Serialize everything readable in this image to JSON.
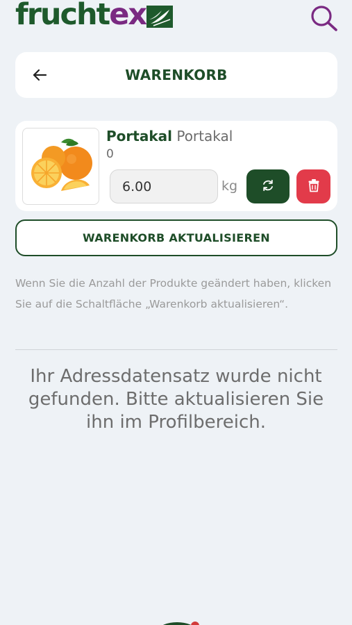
{
  "header": {
    "logo_part1": "frucht",
    "logo_part2": "ex",
    "search_icon": "search-icon"
  },
  "title_bar": {
    "title": "WARENKORB",
    "back_icon": "arrow-left-icon"
  },
  "cart": {
    "items": [
      {
        "name_bold": "Portakal",
        "name_light": "Portakal",
        "price": "0",
        "quantity": "6.00",
        "unit": "kg",
        "refresh_icon": "refresh-icon",
        "delete_icon": "trash-icon"
      }
    ]
  },
  "update_button": "WARENKORB AKTUALISIEREN",
  "hint": "Wenn Sie die Anzahl der Produkte geändert haben, klicken Sie auf die Schaltfläche „Warenkorb aktualisieren“.",
  "notice": "Ihr Adressdatensatz wurde nicht gefunden. Bitte aktualisieren Sie ihn im Profilbereich.",
  "colors": {
    "brand_green": "#1e4d28",
    "brand_purple": "#7a2a82",
    "delete_red": "#e23b4a",
    "background": "#eef2f6"
  }
}
